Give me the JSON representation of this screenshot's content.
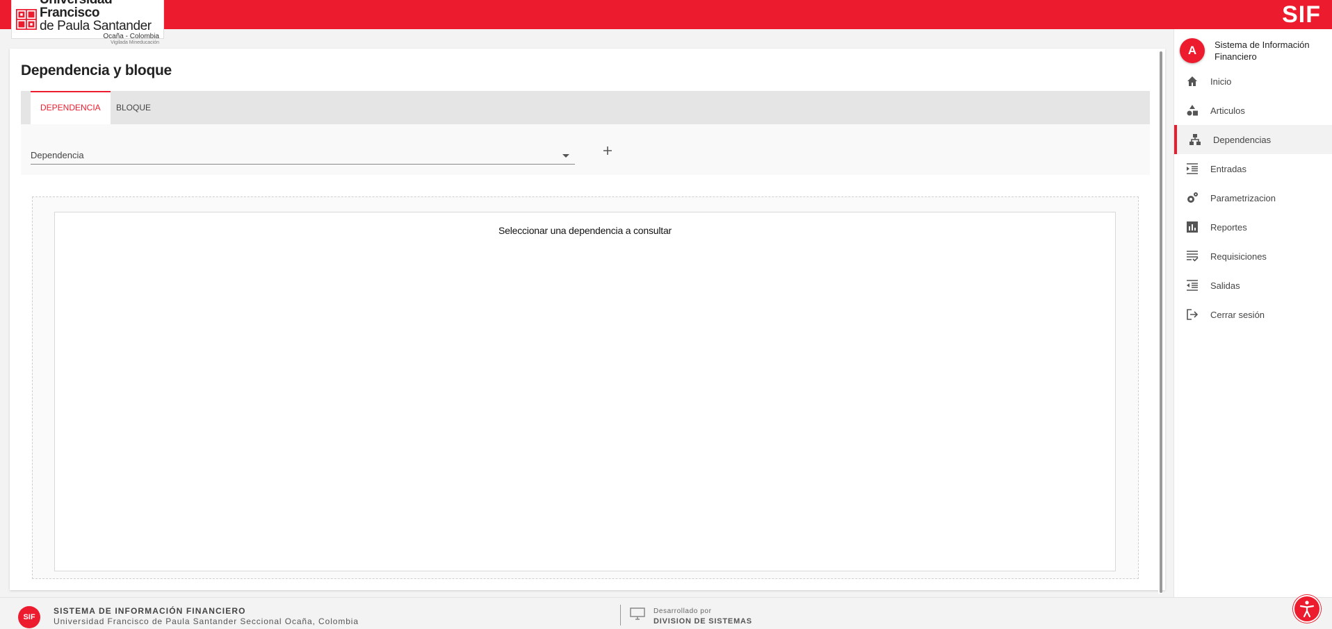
{
  "brand": {
    "logo_line1": "Universidad Francisco",
    "logo_line2": "de Paula Santander",
    "logo_line3": "Ocaña - Colombia",
    "logo_line4": "Vigilada Mineducación",
    "app_short": "SIF",
    "accent_color": "#ec1c2e"
  },
  "page": {
    "title": "Dependencia y bloque",
    "tabs": [
      {
        "label": "DEPENDENCIA",
        "active": true
      },
      {
        "label": "BLOQUE",
        "active": false
      }
    ],
    "select": {
      "label": "Dependencia",
      "value": ""
    },
    "add_icon": "plus-icon",
    "empty_message": "Seleccionar una dependencia a consultar"
  },
  "sidebar": {
    "avatar_initial": "A",
    "title": "Sistema de Información Financiero",
    "items": [
      {
        "label": "Inicio",
        "icon": "home-icon"
      },
      {
        "label": "Articulos",
        "icon": "shapes-icon"
      },
      {
        "label": "Dependencias",
        "icon": "hierarchy-icon",
        "active": true
      },
      {
        "label": "Entradas",
        "icon": "indent-icon"
      },
      {
        "label": "Parametrizacion",
        "icon": "gears-icon"
      },
      {
        "label": "Reportes",
        "icon": "bar-chart-icon"
      },
      {
        "label": "Requisiciones",
        "icon": "checklist-icon"
      },
      {
        "label": "Salidas",
        "icon": "outdent-icon"
      },
      {
        "label": "Cerrar sesión",
        "icon": "logout-icon"
      }
    ]
  },
  "footer": {
    "title": "SISTEMA DE INFORMACIÓN FINANCIERO",
    "subtitle": "Universidad Francisco de Paula Santander Seccional Ocaña, Colombia",
    "dev_label": "Desarrollado por",
    "dev_name": "DIVISION DE SISTEMAS",
    "logo_text": "SIF",
    "accessibility_icon": "accessibility-icon"
  }
}
